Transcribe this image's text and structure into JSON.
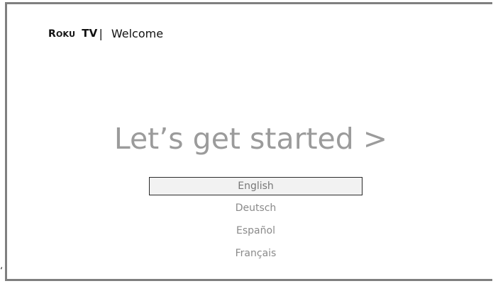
{
  "header": {
    "brand_r": "R",
    "brand_oku": "OKU",
    "brand_tv": "TV",
    "divider": "|",
    "title": "Welcome"
  },
  "main": {
    "headline": "Let’s get started >",
    "languages": [
      {
        "label": "English",
        "selected": true
      },
      {
        "label": "Deutsch",
        "selected": false
      },
      {
        "label": "Español",
        "selected": false
      },
      {
        "label": "Français",
        "selected": false
      }
    ]
  },
  "colors": {
    "frame_border": "#7f7f7f",
    "headline_text": "#9b9b9b",
    "selection_border": "#2a2a2a",
    "selection_fill": "#f2f2f2"
  },
  "corner_mark": "‘"
}
